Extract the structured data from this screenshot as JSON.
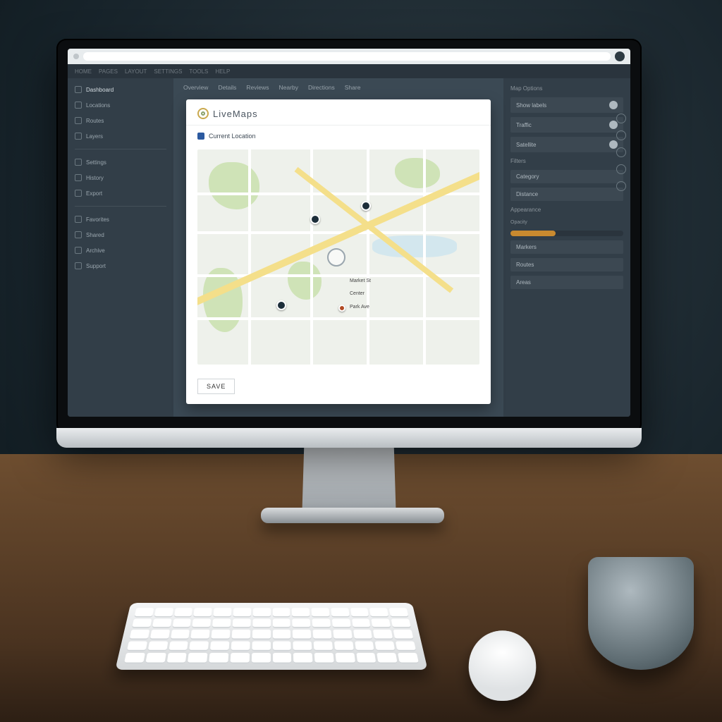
{
  "browser": {
    "title": ""
  },
  "topnav": {
    "items": [
      "HOME",
      "PAGES",
      "LAYOUT",
      "SETTINGS",
      "TOOLS",
      "HELP"
    ]
  },
  "sidebar": {
    "groups": [
      {
        "label": "Dashboard"
      },
      {
        "label": "Locations"
      },
      {
        "label": "Routes"
      },
      {
        "label": "Layers"
      },
      {
        "label": "Settings"
      },
      {
        "label": "History"
      },
      {
        "label": "Export"
      },
      {
        "label": "Favorites"
      },
      {
        "label": "Shared"
      },
      {
        "label": "Archive"
      },
      {
        "label": "Support"
      }
    ]
  },
  "tabs": {
    "items": [
      "Overview",
      "Details",
      "Reviews",
      "Nearby",
      "Directions",
      "Share"
    ]
  },
  "card": {
    "brand": "LiveMaps",
    "section_label": "Current Location",
    "map_labels": [
      "Market St",
      "Center",
      "Park Ave"
    ],
    "save_label": "SAVE",
    "footnote": ""
  },
  "rightpanel": {
    "header1": "Map Options",
    "rows1": [
      "Show labels",
      "Traffic",
      "Satellite"
    ],
    "header2": "Filters",
    "rows2": [
      "Category",
      "Distance"
    ],
    "header3": "Appearance",
    "slider_label": "Opacity",
    "rows3": [
      "Markers",
      "Routes",
      "Areas"
    ]
  },
  "colors": {
    "panel": "#323e48",
    "accent": "#c98a2f"
  }
}
